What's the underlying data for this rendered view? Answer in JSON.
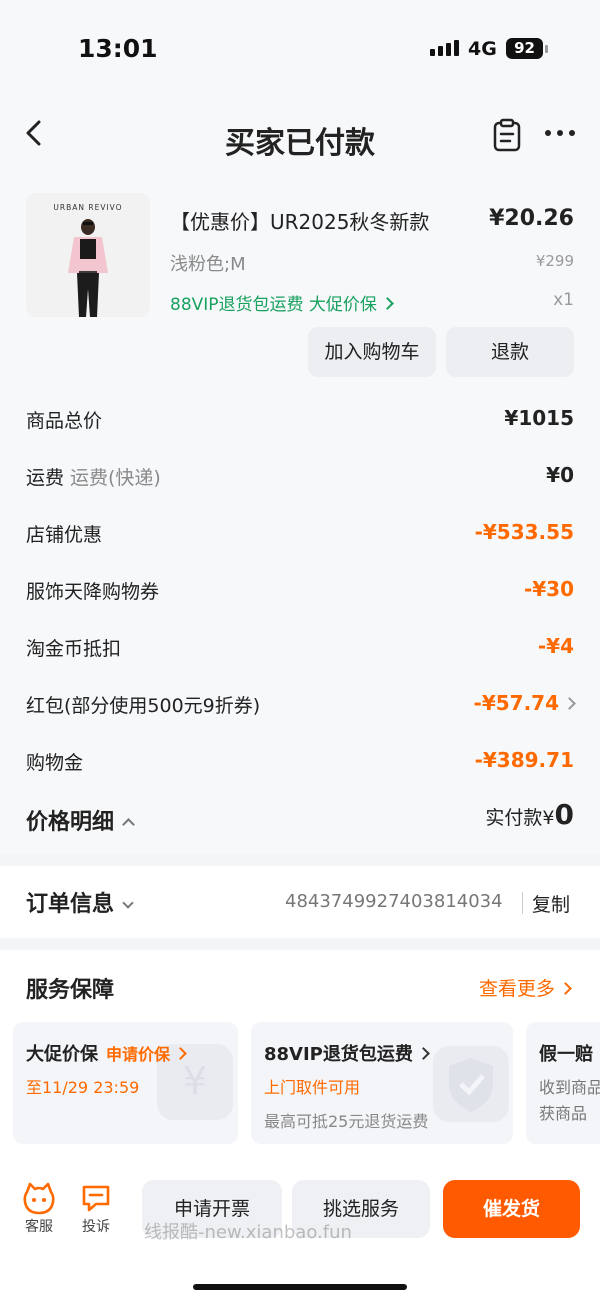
{
  "status": {
    "time": "13:01",
    "network": "4G",
    "battery": "92"
  },
  "nav": {
    "title": "买家已付款"
  },
  "product": {
    "brand": "URBAN REVIVO",
    "title": "【优惠价】UR2025秋冬新款",
    "price": "¥20.26",
    "spec": "浅粉色;M",
    "original_price": "¥299",
    "tags": "88VIP退货包运费  大促价保",
    "quantity": "x1",
    "cart_btn": "加入购物车",
    "refund_btn": "退款"
  },
  "prices": {
    "rows": [
      {
        "label": "商品总价",
        "sub": "",
        "value": "¥1015",
        "orange": false,
        "chevron": false
      },
      {
        "label": "运费",
        "sub": "运费(快递)",
        "value": "¥0",
        "orange": false,
        "chevron": false
      },
      {
        "label": "店铺优惠",
        "sub": "",
        "value": "-¥533.55",
        "orange": true,
        "chevron": false
      },
      {
        "label": "服饰天降购物券",
        "sub": "",
        "value": "-¥30",
        "orange": true,
        "chevron": false
      },
      {
        "label": "淘金币抵扣",
        "sub": "",
        "value": "-¥4",
        "orange": true,
        "chevron": false
      },
      {
        "label": "红包(部分使用500元9折券)",
        "sub": "",
        "value": "-¥57.74",
        "orange": true,
        "chevron": true
      },
      {
        "label": "购物金",
        "sub": "",
        "value": "-¥389.71",
        "orange": true,
        "chevron": false
      }
    ],
    "detail_label": "价格明细",
    "paid_label": "实付款¥",
    "paid_value": "0"
  },
  "order": {
    "title": "订单信息",
    "number": "4843749927403814034",
    "copy": "复制"
  },
  "service": {
    "title": "服务保障",
    "more": "查看更多",
    "cards": [
      {
        "title": "大促价保",
        "link": "申请价保",
        "line2": "至11/29 23:59",
        "line3": ""
      },
      {
        "title": "88VIP退货包运费",
        "link": "",
        "line2": "上门取件可用",
        "line3": "最高可抵25元退货运费"
      },
      {
        "title": "假一赔",
        "link": "",
        "line2": "收到商品",
        "line3": "获商品"
      }
    ]
  },
  "bottom": {
    "service_label": "客服",
    "complain_label": "投诉",
    "invoice_btn": "申请开票",
    "pick_btn": "挑选服务",
    "urge_btn": "催发货",
    "watermark": "线报酷-new.xianbao.fun"
  },
  "colors": {
    "accent": "#ff6a00",
    "green": "#19a15f",
    "primary_button": "#ff5a00"
  }
}
